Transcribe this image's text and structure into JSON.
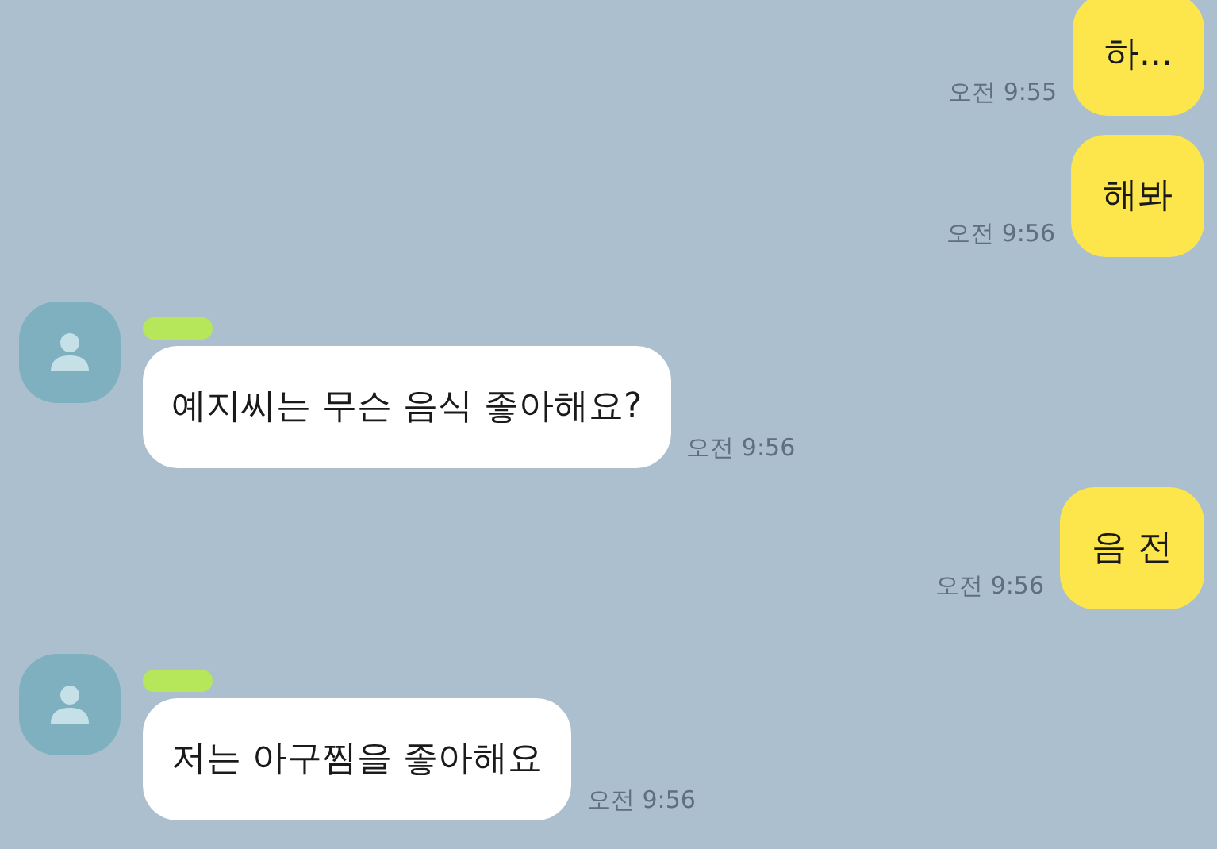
{
  "messages": [
    {
      "kind": "sent",
      "text": "하...",
      "time": "오전 9:55"
    },
    {
      "kind": "sent",
      "text": "해봐",
      "time": "오전 9:56"
    },
    {
      "kind": "received",
      "text": "예지씨는 무슨 음식 좋아해요?",
      "time": "오전 9:56"
    },
    {
      "kind": "sent",
      "text": "음 전",
      "time": "오전 9:56"
    },
    {
      "kind": "received",
      "text": "저는 아구찜을 좋아해요",
      "time": "오전 9:56"
    }
  ]
}
